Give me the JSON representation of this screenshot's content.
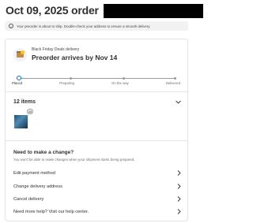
{
  "header": {
    "title": "Oct 09, 2025 order"
  },
  "banner": {
    "text": "Your preorder is about to ship. Double-check your address to ensure a smooth delivery."
  },
  "delivery": {
    "deal_label": "Black Friday Deals delivery",
    "arrives": "Preorder arrives by Nov 14",
    "icon": "box-icon"
  },
  "progress": {
    "current_step": 0,
    "steps": [
      "Placed",
      "Preparing",
      "On the way",
      "Delivered"
    ]
  },
  "items": {
    "title": "12 items",
    "quantity_badge": "12"
  },
  "change": {
    "title": "Need to make a change?",
    "subtitle": "You won't be able to make changes when your shipment starts being prepared.",
    "actions": [
      "Edit payment method",
      "Change delivery address",
      "Cancel delivery",
      "Need more help? Visit our help center."
    ]
  },
  "colors": {
    "accent": "#0071dc",
    "text": "#2e2f32",
    "muted": "#6d6e71"
  }
}
